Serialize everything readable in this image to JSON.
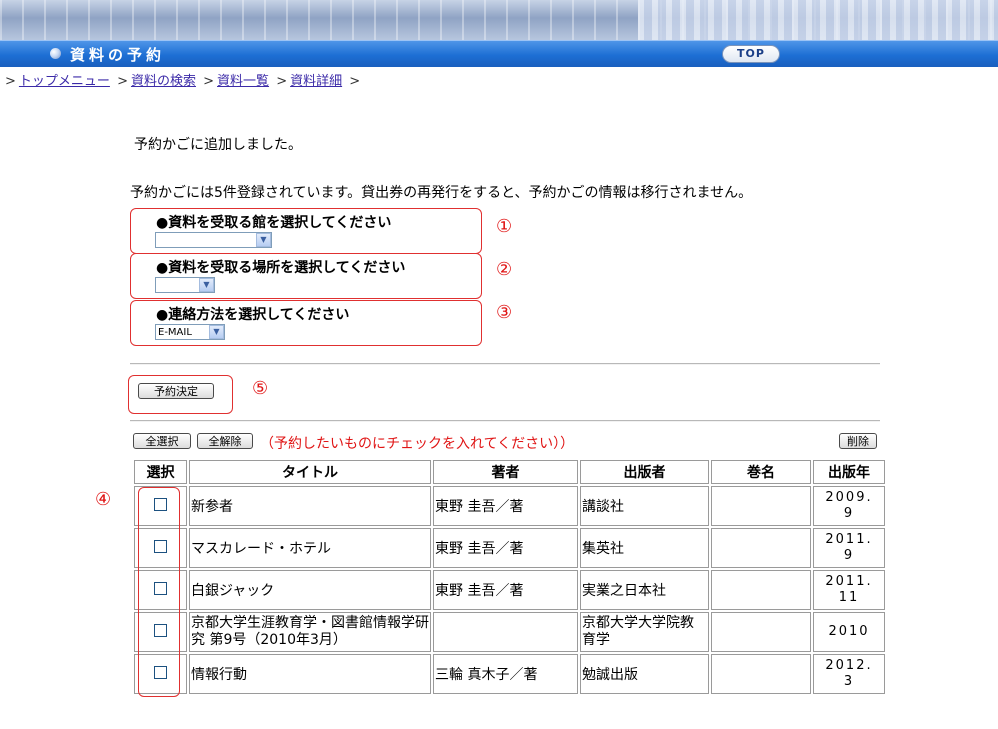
{
  "header": {
    "title": "資料の予約",
    "top_label": "TOP"
  },
  "breadcrumb": {
    "items": [
      "トップメニュー",
      "資料の検索",
      "資料一覧",
      "資料詳細"
    ],
    "sep": ">"
  },
  "messages": {
    "added": "予約かごに追加しました。",
    "status": "予約かごには5件登録されています。貸出券の再発行をすると、予約かごの情報は移行されません。"
  },
  "form": {
    "library": {
      "label": "●資料を受取る館を選択してください",
      "value": "",
      "marker": "①"
    },
    "location": {
      "label": "●資料を受取る場所を選択してください",
      "value": "",
      "marker": "②"
    },
    "contact": {
      "label": "●連絡方法を選択してください",
      "value": "E-MAIL",
      "marker": "③"
    }
  },
  "decide": {
    "label": "予約決定",
    "marker": "⑤"
  },
  "list": {
    "select_all": "全選択",
    "deselect_all": "全解除",
    "hint": "（予約したいものにチェックを入れてください））",
    "delete": "削除",
    "marker": "④",
    "columns": [
      "選択",
      "タイトル",
      "著者",
      "出版者",
      "巻名",
      "出版年"
    ],
    "rows": [
      {
        "title": "新参者",
        "author": "東野 圭吾／著",
        "publisher": "講談社",
        "volume": "",
        "year_1": "2009.",
        "year_2": "9"
      },
      {
        "title": "マスカレード・ホテル",
        "author": "東野 圭吾／著",
        "publisher": "集英社",
        "volume": "",
        "year_1": "2011.",
        "year_2": "9"
      },
      {
        "title": "白銀ジャック",
        "author": "東野 圭吾／著",
        "publisher": "実業之日本社",
        "volume": "",
        "year_1": "2011.",
        "year_2": "11"
      },
      {
        "title": "京都大学生涯教育学・図書館情報学研究 第9号（2010年3月）",
        "author": "",
        "publisher": "京都大学大学院教育学",
        "volume": "",
        "year_1": "2010",
        "year_2": ""
      },
      {
        "title": "情報行動",
        "author": "三輪 真木子／著",
        "publisher": "勉誠出版",
        "volume": "",
        "year_1": "2012.",
        "year_2": "3"
      }
    ]
  }
}
